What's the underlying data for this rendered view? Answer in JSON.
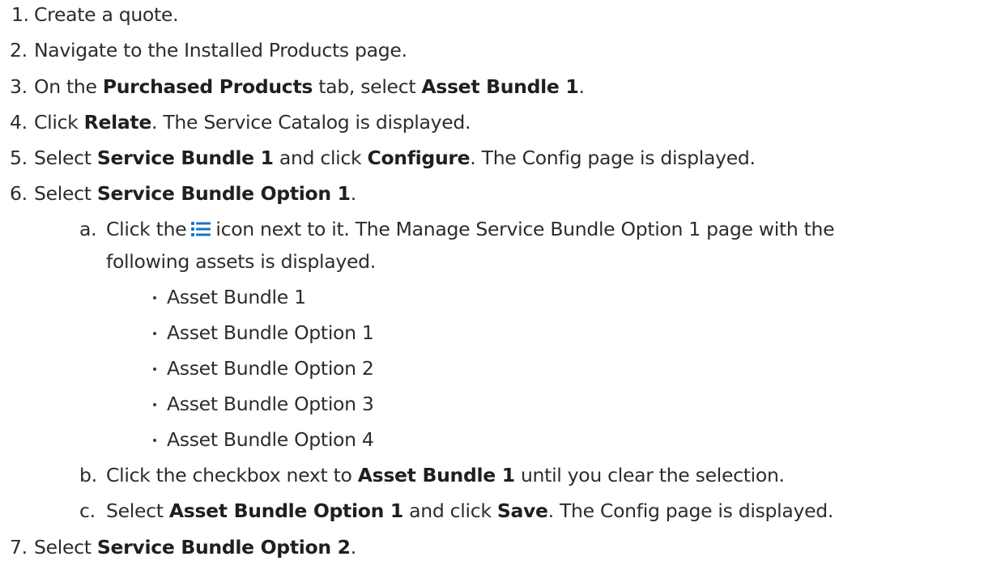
{
  "steps": [
    {
      "num": "1.",
      "parts": [
        "Create a quote."
      ]
    },
    {
      "num": "2.",
      "parts": [
        "Navigate to the Installed Products page."
      ]
    },
    {
      "num": "3.",
      "parts": [
        "On the ",
        "Purchased Products",
        " tab, select ",
        "Asset Bundle 1",
        "."
      ]
    },
    {
      "num": "4.",
      "parts": [
        "Click ",
        "Relate",
        ". The Service Catalog is displayed."
      ]
    },
    {
      "num": "5.",
      "parts": [
        "Select ",
        "Service Bundle 1",
        " and click ",
        "Configure",
        ". The Config page is displayed."
      ]
    },
    {
      "num": "6.",
      "parts": [
        "Select ",
        "Service Bundle Option 1",
        "."
      ]
    },
    {
      "num": "7.",
      "parts": [
        "Select ",
        "Service Bundle Option 2",
        "."
      ]
    }
  ],
  "substeps": [
    {
      "letter": "a.",
      "before_icon": "Click the",
      "after_icon": "icon next to it. The Manage Service Bundle Option 1 page with the",
      "continuation": "following assets is displayed.",
      "icon": "list-icon",
      "icon_color": "#1a73c9"
    },
    {
      "letter": "b.",
      "parts": [
        "Click the checkbox next to ",
        "Asset Bundle 1",
        " until you clear the selection."
      ]
    },
    {
      "letter": "c.",
      "parts": [
        "Select ",
        "Asset Bundle Option 1",
        " and click ",
        "Save",
        ". The Config page is displayed."
      ]
    }
  ],
  "bullets": [
    "Asset Bundle 1",
    "Asset Bundle Option 1",
    "Asset Bundle Option 2",
    "Asset Bundle Option 3",
    "Asset Bundle Option 4"
  ]
}
